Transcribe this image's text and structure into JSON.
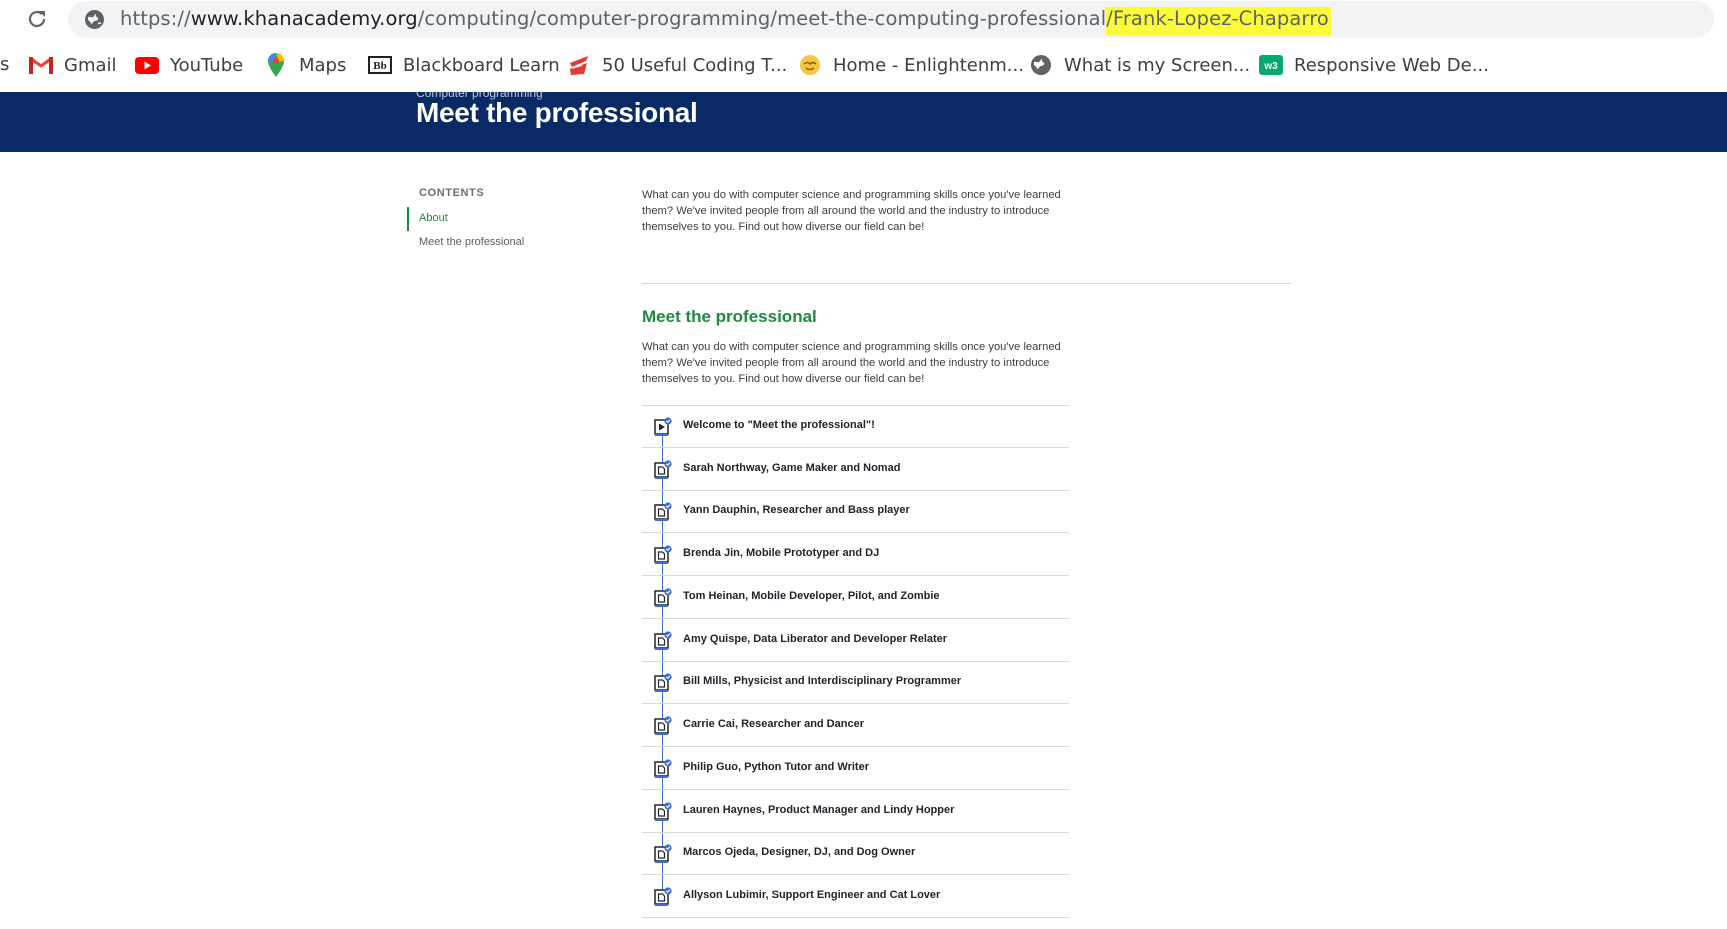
{
  "browser": {
    "url": {
      "scheme": "https://",
      "host": "www.khanacademy.org",
      "path": "/computing/computer-programming/meet-the-computing-professional",
      "highlighted": "/Frank-Lopez-Chaparro"
    },
    "bookmark_cut": "s",
    "bookmarks": [
      {
        "label": "Gmail",
        "icon": "gmail-icon"
      },
      {
        "label": "YouTube",
        "icon": "youtube-icon"
      },
      {
        "label": "Maps",
        "icon": "maps-icon"
      },
      {
        "label": "Blackboard Learn",
        "icon": "blackboard-icon"
      },
      {
        "label": "50 Useful Coding T...",
        "icon": "bookmark-site-icon"
      },
      {
        "label": "Home - Enlightenm...",
        "icon": "emoji-icon"
      },
      {
        "label": "What is my Screen...",
        "icon": "globe-icon"
      },
      {
        "label": "Responsive Web De...",
        "icon": "w3-icon"
      }
    ]
  },
  "header": {
    "breadcrumb": "Computer programming",
    "title": "Meet the professional"
  },
  "sidebar": {
    "heading": "CONTENTS",
    "items": [
      {
        "label": "About",
        "active": true
      },
      {
        "label": "Meet the professional",
        "active": false
      }
    ]
  },
  "main": {
    "intro": "What can you do with computer science and programming skills once you've learned them? We've invited people from all around the world and the industry to introduce themselves to you. Find out how diverse our field can be!",
    "section_title": "Meet the professional",
    "section_intro": "What can you do with computer science and programming skills once you've learned them? We've invited people from all around the world and the industry to introduce themselves to you. Find out how diverse our field can be!",
    "items": [
      {
        "title": "Welcome to \"Meet the professional\"!",
        "icon": "video-icon"
      },
      {
        "title": "Sarah Northway, Game Maker and Nomad",
        "icon": "article-icon"
      },
      {
        "title": "Yann Dauphin, Researcher and Bass player",
        "icon": "article-icon"
      },
      {
        "title": "Brenda Jin, Mobile Prototyper and DJ",
        "icon": "article-icon"
      },
      {
        "title": "Tom Heinan, Mobile Developer, Pilot, and Zombie",
        "icon": "article-icon"
      },
      {
        "title": "Amy Quispe, Data Liberator and Developer Relater",
        "icon": "article-icon"
      },
      {
        "title": "Bill Mills, Physicist and Interdisciplinary Programmer",
        "icon": "article-icon"
      },
      {
        "title": "Carrie Cai, Researcher and Dancer",
        "icon": "article-icon"
      },
      {
        "title": "Philip Guo, Python Tutor and Writer",
        "icon": "article-icon"
      },
      {
        "title": "Lauren Haynes, Product Manager and Lindy Hopper",
        "icon": "article-icon"
      },
      {
        "title": "Marcos Ojeda, Designer, DJ, and Dog Owner",
        "icon": "article-icon"
      },
      {
        "title": "Allyson Lubimir, Support Engineer and Cat Lover",
        "icon": "article-icon"
      }
    ]
  },
  "colors": {
    "header_bg": "#0a2a66",
    "accent_green": "#1f8a3f",
    "timeline_blue": "#3b6fd6",
    "url_highlight": "#fbfb3a"
  }
}
